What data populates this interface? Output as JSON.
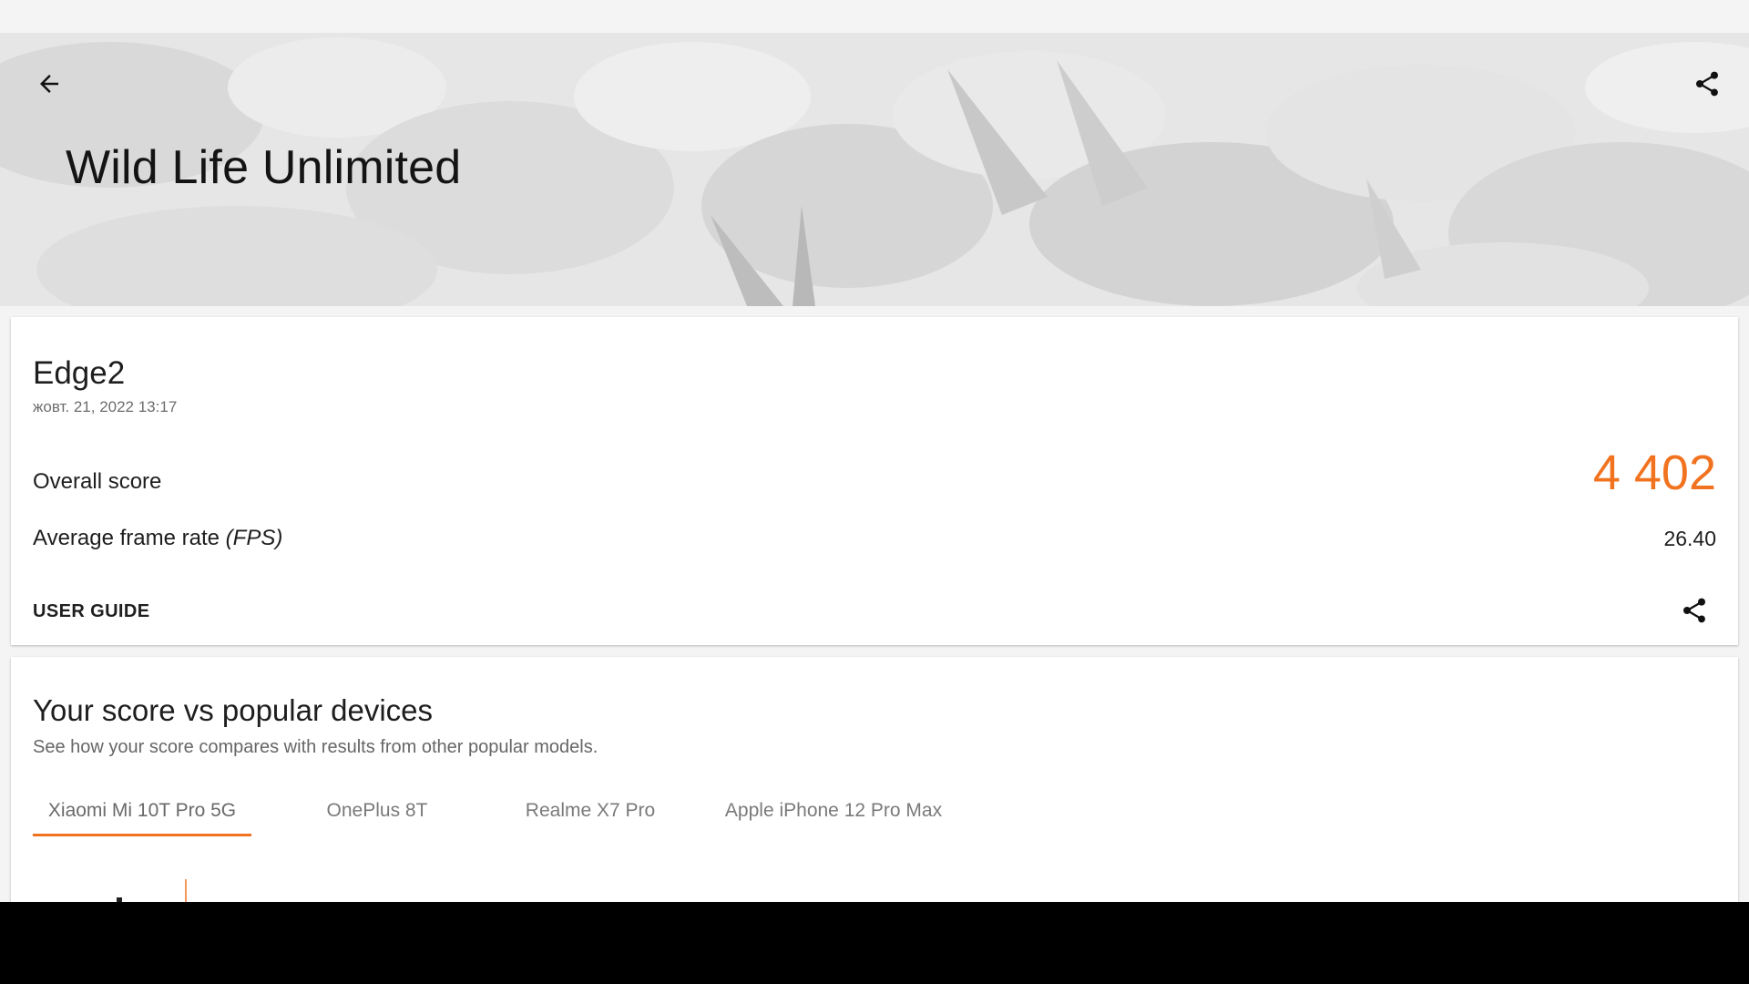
{
  "header": {
    "title": "Wild Life Unlimited",
    "back_icon": "arrow-back-icon",
    "share_icon": "share-icon"
  },
  "result": {
    "device_name": "Edge2",
    "date": "жовт. 21, 2022 13:17",
    "overall_label": "Overall score",
    "overall_value": "4 402",
    "fps_label_main": "Average frame rate",
    "fps_label_unit": "(FPS)",
    "fps_value": "26.40",
    "user_guide_label": "USER GUIDE",
    "share_icon": "share-icon"
  },
  "comparison": {
    "title": "Your score vs popular devices",
    "subtitle": "See how your score compares with results from other popular models.",
    "tabs": [
      {
        "label": "Xiaomi Mi 10T Pro 5G",
        "active": true
      },
      {
        "label": "OnePlus 8T",
        "active": false
      },
      {
        "label": "Realme X7 Pro",
        "active": false
      },
      {
        "label": "Apple iPhone 12 Pro Max",
        "active": false
      }
    ]
  },
  "colors": {
    "accent": "#f2731f",
    "text": "#1e1e1e",
    "muted": "#6d6d6d",
    "navbar": "#000000"
  }
}
